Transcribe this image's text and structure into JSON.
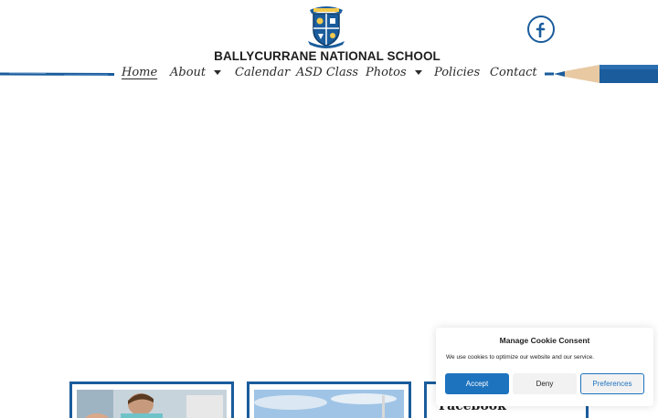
{
  "header": {
    "school_name": "BALLYCURRANE NATIONAL SCHOOL",
    "crest_icon": "school-crest-icon",
    "facebook_icon": "facebook-icon"
  },
  "nav": {
    "items": [
      {
        "label": "Home",
        "active": true,
        "has_dropdown": false
      },
      {
        "label": "About",
        "active": false,
        "has_dropdown": true
      },
      {
        "label": "Calendar",
        "active": false,
        "has_dropdown": false
      },
      {
        "label": "ASD Class",
        "active": false,
        "has_dropdown": false
      },
      {
        "label": "Photos",
        "active": false,
        "has_dropdown": true
      },
      {
        "label": "Policies",
        "active": false,
        "has_dropdown": false
      },
      {
        "label": "Contact",
        "active": false,
        "has_dropdown": false
      }
    ]
  },
  "cards": {
    "third_title": "Facebook"
  },
  "cookie": {
    "title": "Manage Cookie Consent",
    "text": "We use cookies to optimize our website and our service.",
    "accept_label": "Accept",
    "deny_label": "Deny",
    "preferences_label": "Preferences"
  },
  "colors": {
    "brand_blue": "#1a5c9c",
    "accept_blue": "#1e73be"
  }
}
